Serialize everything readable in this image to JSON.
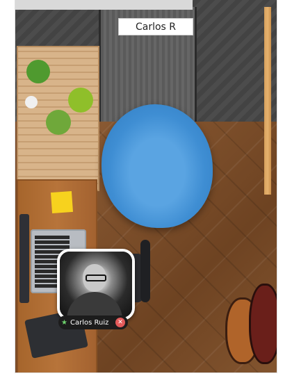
{
  "room": {
    "name_tag": "Carlos R"
  },
  "user": {
    "display_name": "Carlos Ruiz",
    "status_icon": "star-icon",
    "mic_state": "muted",
    "mic_icon": "mic-off-icon"
  },
  "colors": {
    "beanbag": "#3f8ed3",
    "status_green": "#6ed36e",
    "mic_red": "#e35a5a"
  }
}
